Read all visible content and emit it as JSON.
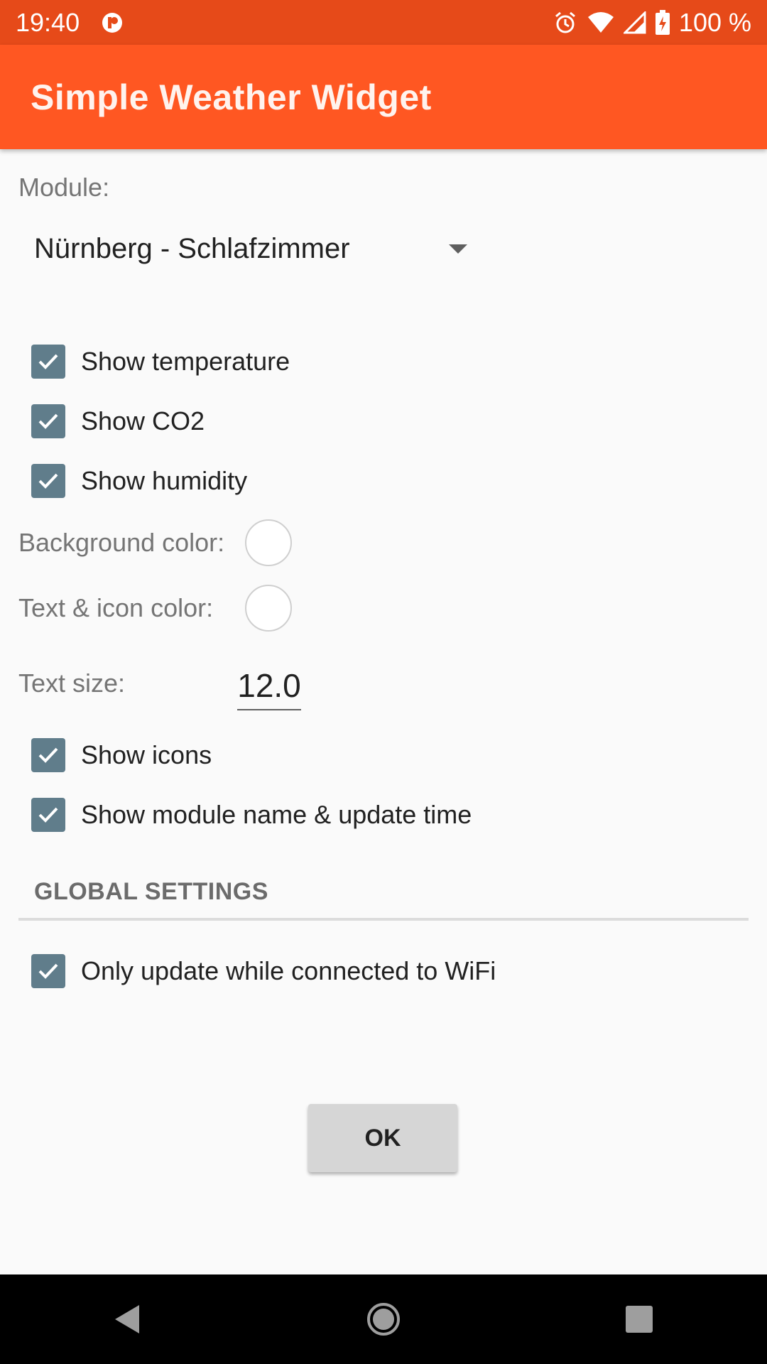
{
  "status_bar": {
    "time": "19:40",
    "battery": "100 %",
    "icons": [
      "app-notification-icon",
      "alarm-icon",
      "wifi-icon",
      "signal-icon",
      "battery-charging-icon"
    ]
  },
  "app_bar": {
    "title": "Simple Weather Widget"
  },
  "module": {
    "label": "Module:",
    "selected": "Nürnberg - Schlafzimmer"
  },
  "options": {
    "show_temperature": {
      "label": "Show temperature",
      "checked": true
    },
    "show_co2": {
      "label": "Show CO2",
      "checked": true
    },
    "show_humidity": {
      "label": "Show humidity",
      "checked": true
    },
    "show_icons": {
      "label": "Show icons",
      "checked": true
    },
    "show_module_name": {
      "label": "Show module name & update time",
      "checked": true
    }
  },
  "colors": {
    "background_label": "Background color:",
    "background_value": "#FFFFFF",
    "text_icon_label": "Text & icon color:",
    "text_icon_value": "#FFFFFF"
  },
  "text_size": {
    "label": "Text size:",
    "value": "12.0"
  },
  "global_settings": {
    "header": "GLOBAL SETTINGS",
    "wifi_only": {
      "label": "Only update while connected to WiFi",
      "checked": true
    }
  },
  "ok_button": {
    "label": "OK"
  },
  "theme": {
    "primary": "#FF5722",
    "primary_dark": "#E64A19",
    "checkbox": "#607D8B"
  }
}
